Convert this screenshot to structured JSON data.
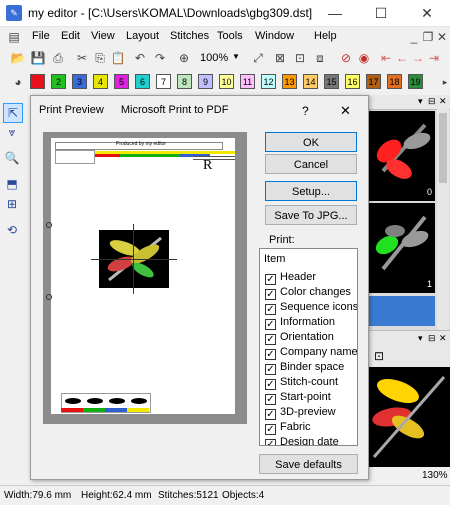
{
  "window": {
    "title": "my editor - [C:\\Users\\KOMAL\\Downloads\\gbg309.dst]",
    "minimize": "—",
    "maximize": "☐",
    "close": "✕"
  },
  "menu": {
    "items": [
      "File",
      "Edit",
      "View",
      "Layout",
      "Stitches",
      "Tools",
      "Window",
      "Help"
    ]
  },
  "toolbar": {
    "zoom": "100%"
  },
  "colorbar": {
    "swatches": [
      {
        "label": "",
        "color": "#e8101a"
      },
      {
        "label": "2",
        "color": "#20c020"
      },
      {
        "label": "3",
        "color": "#3b6ad9"
      },
      {
        "label": "4",
        "color": "#e6e600"
      },
      {
        "label": "5",
        "color": "#e020e0"
      },
      {
        "label": "6",
        "color": "#20d0d0"
      },
      {
        "label": "7",
        "color": "#ffffff"
      },
      {
        "label": "8",
        "color": "#bfe6bf"
      },
      {
        "label": "9",
        "color": "#c0c0ff"
      },
      {
        "label": "10",
        "color": "#ffff99"
      },
      {
        "label": "11",
        "color": "#ffc0ff"
      },
      {
        "label": "12",
        "color": "#c0ffff"
      },
      {
        "label": "13",
        "color": "#ff9900"
      },
      {
        "label": "14",
        "color": "#ffcc66"
      },
      {
        "label": "15",
        "color": "#777777"
      },
      {
        "label": "16",
        "color": "#ffff66"
      },
      {
        "label": "17",
        "color": "#b06010"
      },
      {
        "label": "18",
        "color": "#e07020"
      },
      {
        "label": "19",
        "color": "#2c8c3c"
      }
    ]
  },
  "dialog": {
    "title": "Print Preview",
    "printer": "Microsoft Print to PDF",
    "help": "?",
    "close": "✕",
    "buttons": {
      "ok": "OK",
      "cancel": "Cancel",
      "setup": "Setup...",
      "save_jpg": "Save To JPG...",
      "save_defaults": "Save defaults"
    },
    "print_label": "Print:",
    "list_header": "Item",
    "items": [
      {
        "label": "Header",
        "checked": true
      },
      {
        "label": "Color changes",
        "checked": true
      },
      {
        "label": "Sequence icons",
        "checked": true
      },
      {
        "label": "Information",
        "checked": true
      },
      {
        "label": "Orientation",
        "checked": true
      },
      {
        "label": "Company name",
        "checked": true
      },
      {
        "label": "Binder space",
        "checked": true
      },
      {
        "label": "Stitch-count",
        "checked": true
      },
      {
        "label": "Start-point",
        "checked": true
      },
      {
        "label": "3D-preview",
        "checked": true
      },
      {
        "label": "Fabric",
        "checked": true
      },
      {
        "label": "Design date",
        "checked": true
      }
    ],
    "page_mark": "R",
    "page_header_text": "Produced by my editor"
  },
  "right_panel": {
    "thumb_labels": [
      "0",
      "1"
    ]
  },
  "status": {
    "width": "Width:79.6 mm",
    "height": "Height:62.4 mm",
    "stitches": "Stitches:5121",
    "objects": "Objects:4",
    "zoom": "130%"
  }
}
